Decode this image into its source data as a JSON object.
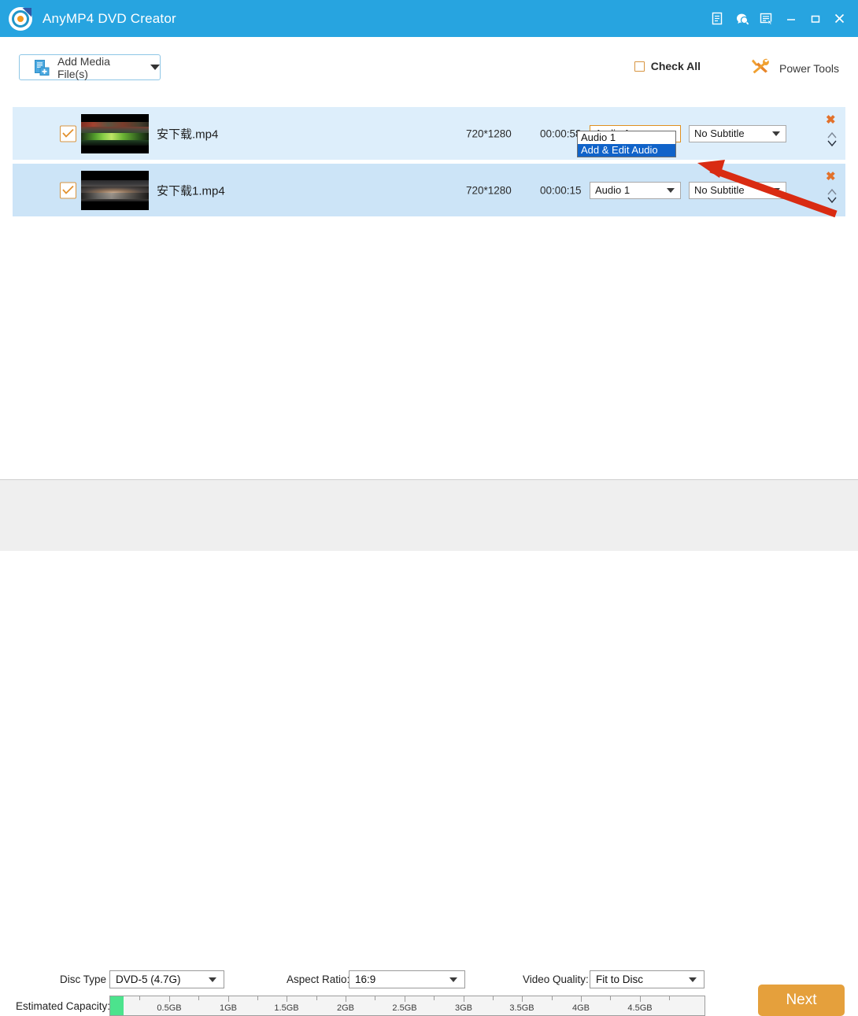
{
  "window": {
    "app_title": "AnyMP4 DVD Creator",
    "logo_icon": "anymp4-logo-icon",
    "controls": [
      {
        "name": "register-icon",
        "title": "Register"
      },
      {
        "name": "help-icon",
        "title": "Help"
      },
      {
        "name": "menu-icon",
        "title": "Menu"
      },
      {
        "name": "minimize-icon",
        "title": "Minimize"
      },
      {
        "name": "maximize-icon",
        "title": "Maximize"
      },
      {
        "name": "close-icon",
        "title": "Close"
      }
    ],
    "accent_blue": "#27a4e0"
  },
  "toolbar": {
    "add_media_label": "Add Media File(s)",
    "add_media_icon": "add-file-icon",
    "check_all_label": "Check All",
    "check_all_checked": false,
    "power_tools_label": "Power Tools",
    "power_tools_icon": "power-tools-icon",
    "accent_orange": "#e0912c"
  },
  "file_list": {
    "columns": [
      "checkbox",
      "thumbnail",
      "filename",
      "resolution",
      "duration",
      "audio",
      "subtitle",
      "actions"
    ],
    "rows": [
      {
        "filename": "安下载.mp4",
        "resolution": "720*1280",
        "duration": "00:00:58",
        "audio": "Audio 1",
        "subtitle": "No Subtitle",
        "checked": true,
        "audio_open": true
      },
      {
        "filename": "安下载1.mp4",
        "resolution": "720*1280",
        "duration": "00:00:15",
        "audio": "Audio 1",
        "subtitle": "No Subtitle",
        "checked": true,
        "audio_open": false
      }
    ],
    "audio_dropdown": {
      "options": [
        "Audio 1",
        "Add & Edit Audio"
      ],
      "selected_index": 1,
      "highlight_color": "#1063c9"
    },
    "row_bg_1": "#ddeefb",
    "row_bg_2": "#cce4f7"
  },
  "annotation": {
    "arrow_color": "#d92b12",
    "arrow_name": "red-pointer-arrow"
  },
  "bottom": {
    "disc_type_label": "Disc Type",
    "disc_type_value": "DVD-5 (4.7G)",
    "aspect_ratio_label": "Aspect Ratio:",
    "aspect_ratio_value": "16:9",
    "video_quality_label": "Video Quality:",
    "video_quality_value": "Fit to Disc",
    "capacity_label": "Estimated Capacity:",
    "capacity_ticks": [
      "0.5GB",
      "1GB",
      "1.5GB",
      "2GB",
      "2.5GB",
      "3GB",
      "3.5GB",
      "4GB",
      "4.5GB"
    ],
    "capacity_fill_percent": 2.3,
    "capacity_fill_color": "#4ce38d",
    "next_label": "Next",
    "next_color": "#e5a03c"
  }
}
